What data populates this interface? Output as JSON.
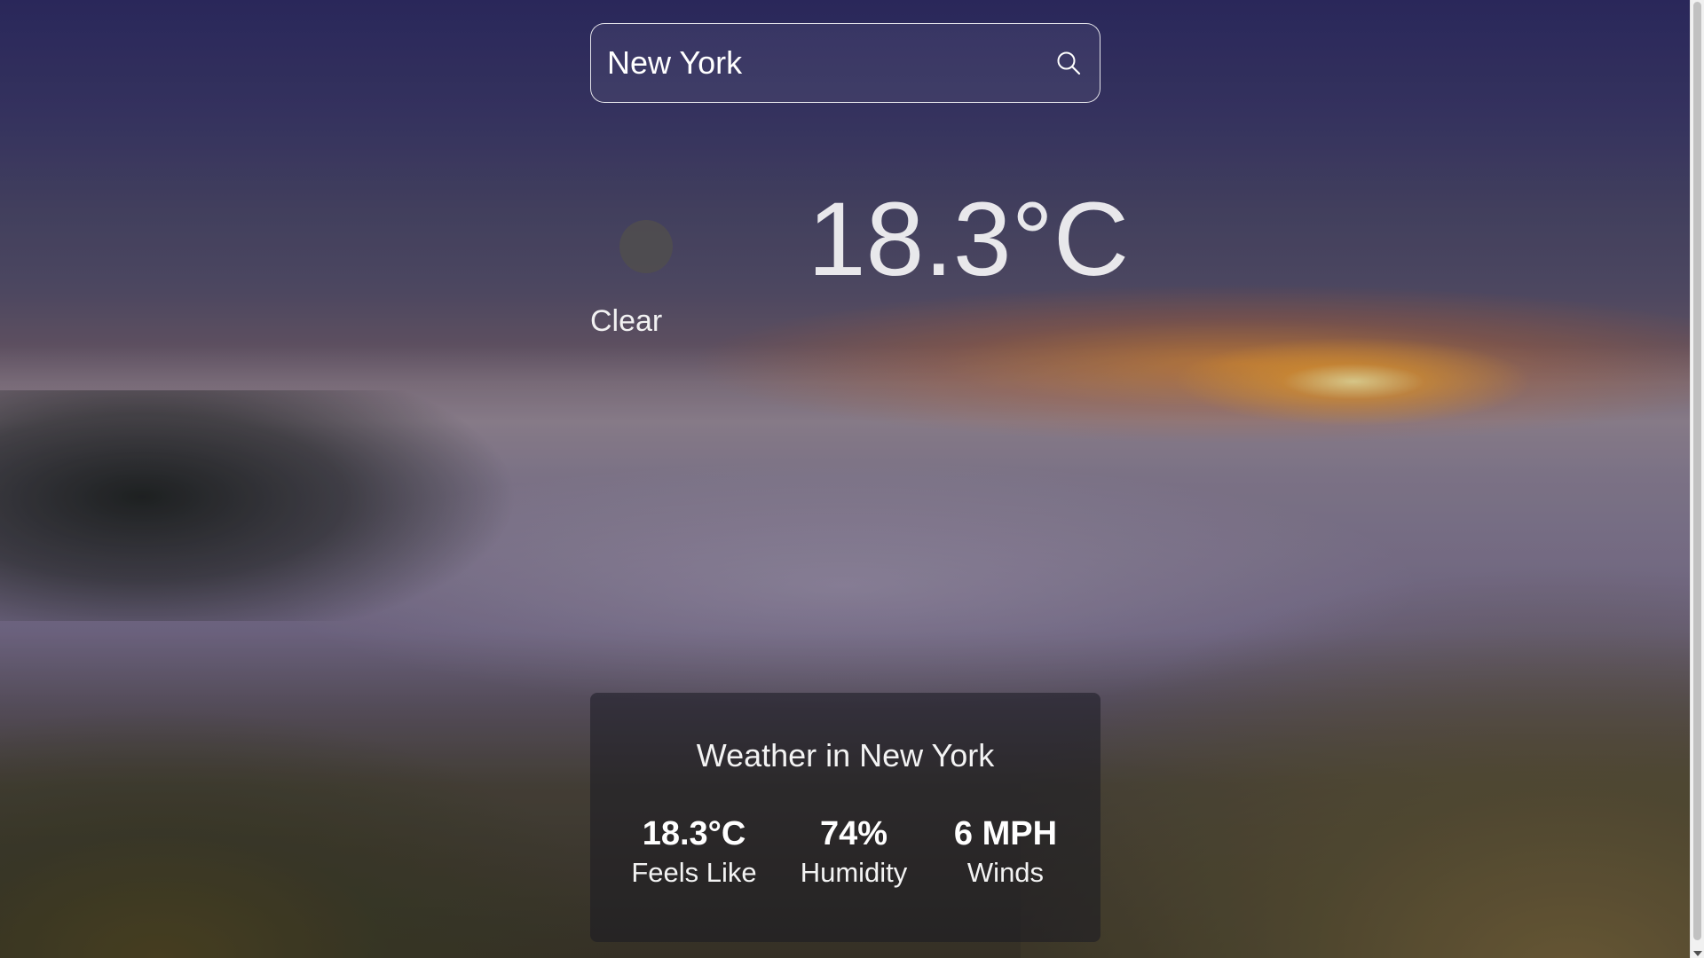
{
  "search": {
    "value": "New York",
    "icon": "search-icon"
  },
  "current": {
    "condition": "Clear",
    "temperature": "18.3°C",
    "icon": "weather-icon"
  },
  "card": {
    "title": "Weather in New York",
    "stats": [
      {
        "value": "18.3°C",
        "label": "Feels Like"
      },
      {
        "value": "74%",
        "label": "Humidity"
      },
      {
        "value": "6 MPH",
        "label": "Winds"
      }
    ]
  },
  "colors": {
    "card_background": "#191923",
    "text": "#ffffff",
    "sunset_accent": "#ff9a1f"
  }
}
